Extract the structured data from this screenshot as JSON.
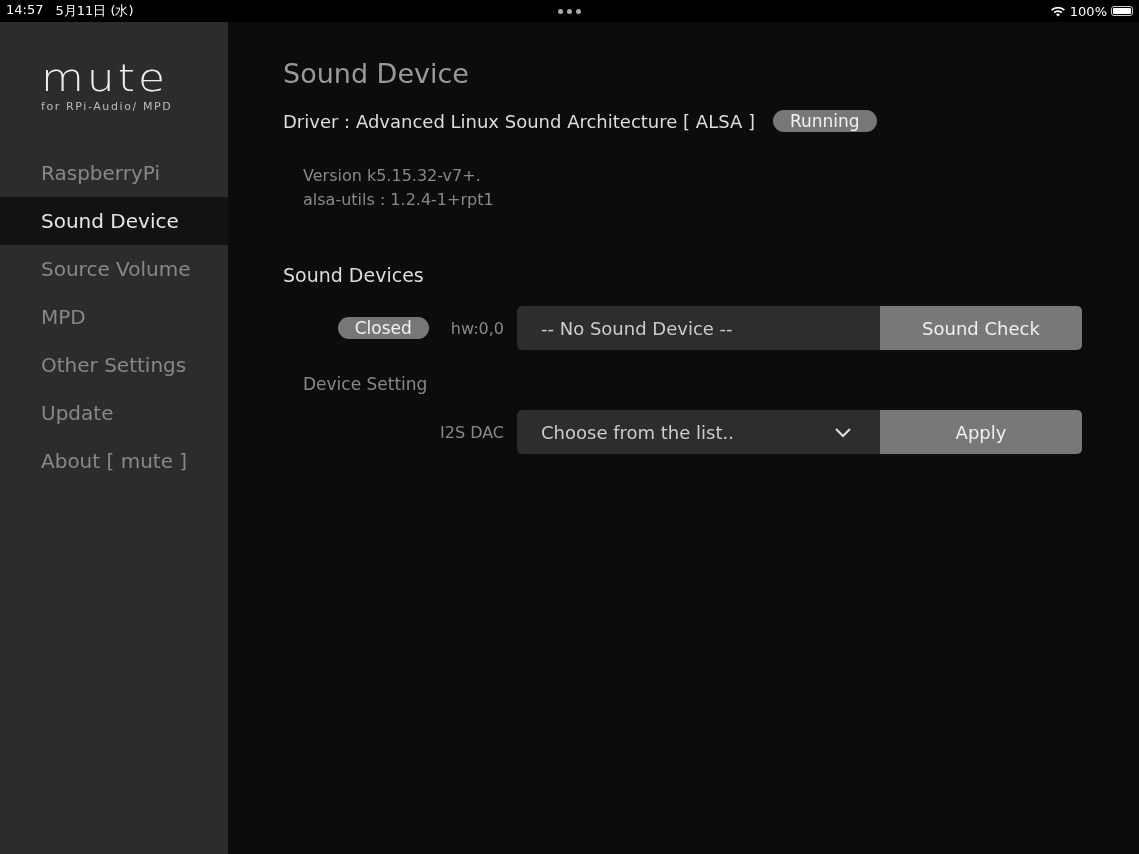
{
  "status_bar": {
    "time": "14:57",
    "date": "5月11日 (水)",
    "battery": "100%"
  },
  "sidebar": {
    "logo": "mute",
    "tagline": "for RPi-Audio/ MPD",
    "items": [
      {
        "label": "RaspberryPi",
        "selected": false
      },
      {
        "label": "Sound Device",
        "selected": true
      },
      {
        "label": "Source Volume",
        "selected": false
      },
      {
        "label": "MPD",
        "selected": false
      },
      {
        "label": "Other Settings",
        "selected": false
      },
      {
        "label": "Update",
        "selected": false
      },
      {
        "label": "About [ mute ]",
        "selected": false
      }
    ]
  },
  "page": {
    "title": "Sound Device",
    "driver": {
      "label": "Driver : Advanced Linux Sound Architecture [ ALSA ]",
      "status": "Running"
    },
    "versions": [
      "Version k5.15.32-v7+.",
      "alsa-utils : 1.2.4-1+rpt1"
    ],
    "devices_heading": "Sound Devices",
    "device": {
      "status": "Closed",
      "id": "hw:0,0",
      "name": "-- No Sound Device --",
      "button": "Sound Check"
    },
    "setting_heading": "Device Setting",
    "setting": {
      "label": "I2S DAC",
      "placeholder": "Choose from the list..",
      "button": "Apply"
    }
  }
}
